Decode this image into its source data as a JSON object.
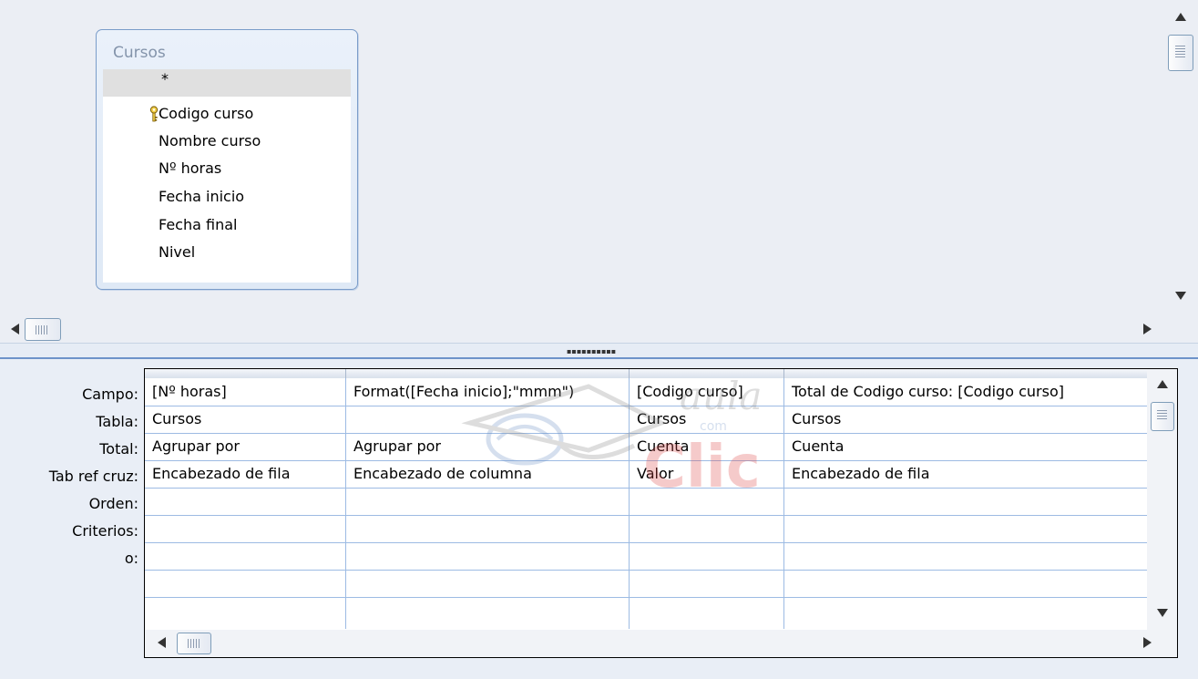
{
  "table": {
    "name": "Cursos",
    "star": "*",
    "fields": [
      "Codigo curso",
      "Nombre curso",
      "Nº horas",
      "Fecha inicio",
      "Fecha final",
      "Nivel"
    ]
  },
  "grid": {
    "row_labels": [
      "Campo:",
      "Tabla:",
      "Total:",
      "Tab ref cruz:",
      "Orden:",
      "Criterios:",
      "o:"
    ],
    "columns": [
      {
        "campo": "[Nº horas]",
        "tabla": "Cursos",
        "total": "Agrupar por",
        "tabref": "Encabezado de fila"
      },
      {
        "campo": "Format([Fecha inicio];\"mmm\")",
        "tabla": "",
        "total": "Agrupar por",
        "tabref": "Encabezado de columna"
      },
      {
        "campo": "[Codigo curso]",
        "tabla": "Cursos",
        "total": "Cuenta",
        "tabref": "Valor"
      },
      {
        "campo": "Total de Codigo curso: [Codigo curso]",
        "tabla": "Cursos",
        "total": "Cuenta",
        "tabref": "Encabezado de fila"
      }
    ]
  },
  "watermark": {
    "text1": "aula",
    "text2": "Clic",
    "text3": "com"
  },
  "icons": {
    "key": "key-icon",
    "up": "arrow-up-icon",
    "down": "arrow-down-icon",
    "left": "arrow-left-icon",
    "right": "arrow-right-icon"
  },
  "colors": {
    "accent": "#6d93c9",
    "grid_line": "#9dbbe3",
    "background": "#ebeef4"
  }
}
